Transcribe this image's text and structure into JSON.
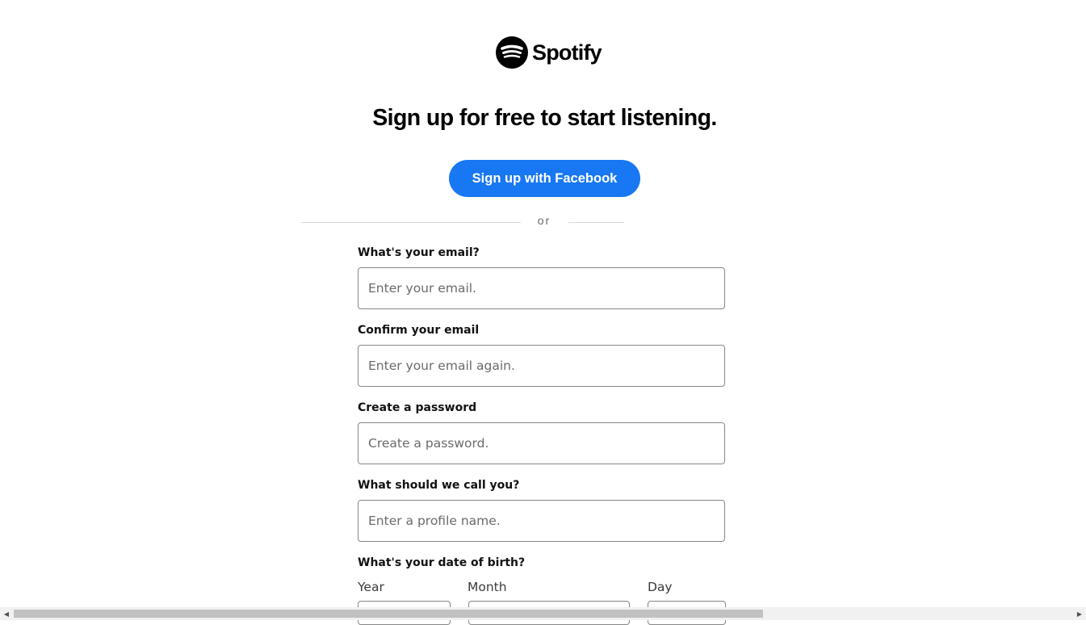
{
  "brand": {
    "name": "Spotify"
  },
  "headline": "Sign up for free to start listening.",
  "facebook_button": "Sign up with Facebook",
  "divider_text": "or",
  "form": {
    "email": {
      "label": "What's your email?",
      "placeholder": "Enter your email."
    },
    "confirm_email": {
      "label": "Confirm your email",
      "placeholder": "Enter your email again."
    },
    "password": {
      "label": "Create a password",
      "placeholder": "Create a password."
    },
    "profile_name": {
      "label": "What should we call you?",
      "placeholder": "Enter a profile name."
    },
    "dob": {
      "label": "What's your date of birth?",
      "year_label": "Year",
      "month_label": "Month",
      "day_label": "Day"
    }
  },
  "colors": {
    "facebook_blue": "#1877f2",
    "brand_black": "#000000"
  },
  "icons": {
    "logo": "spotify-logo-icon",
    "scroll_left": "scroll-left-arrow-icon",
    "scroll_right": "scroll-right-arrow-icon"
  },
  "scrollbar": {
    "horizontal_thumb_fraction": 0.69
  }
}
